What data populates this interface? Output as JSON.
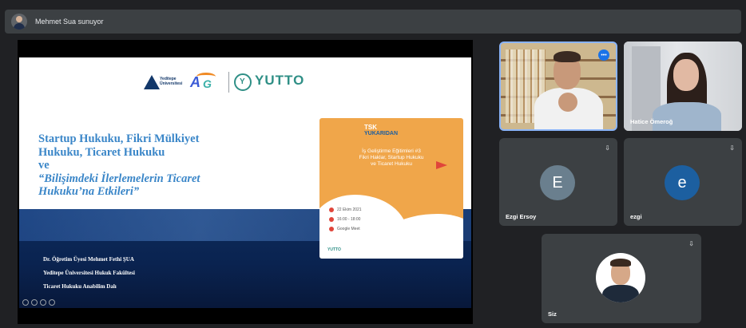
{
  "top_bar": {
    "presenter_text": "Mehmet Sua sunuyor"
  },
  "slide": {
    "title_line1": "Startup Hukuku, Fikri Mülkiyet",
    "title_line2": "Hukuku, Ticaret Hukuku",
    "title_line3": "ve",
    "title_line4": "“Bilişimdeki İlerlemelerin Ticaret",
    "title_line5": "Hukuku’na Etkileri”",
    "presenter_line1": "Dr. Öğretim Üyesi Mehmet Fethi ŞUA",
    "presenter_line2": "Yeditepe Üniversitesi Hukuk Fakültesi",
    "presenter_line3": "Ticaret Hukuku Anabilim Dalı",
    "logo_yeditepe": "Yeditepe Üniversitesi",
    "logo_ag": "AG",
    "logo_yutto": "YUTTO"
  },
  "poster": {
    "brand": "TSK",
    "brand_sub": "YUKARIDAN",
    "heading_line1": "İş Geliştirme Eğitimleri #3",
    "heading_line2": "Fikri Haklar, Startup Hukuku",
    "heading_line3": "ve Ticaret Hukuku",
    "date": "22 Ekim 2021",
    "time": "16:00 - 18:00",
    "venue": "Google Meet",
    "mini_logo": "YUTTO"
  },
  "participants": [
    {
      "name": "",
      "type": "video"
    },
    {
      "name": "Hatice Ömeroğ",
      "type": "video"
    },
    {
      "name": "Ezgi Ersoy",
      "initial": "E",
      "type": "avatar"
    },
    {
      "name": "ezgi",
      "initial": "e",
      "type": "avatar"
    },
    {
      "name": "Siz",
      "type": "self"
    }
  ],
  "icons": {
    "pin": "pin-icon",
    "mic": "mic-active-icon"
  }
}
